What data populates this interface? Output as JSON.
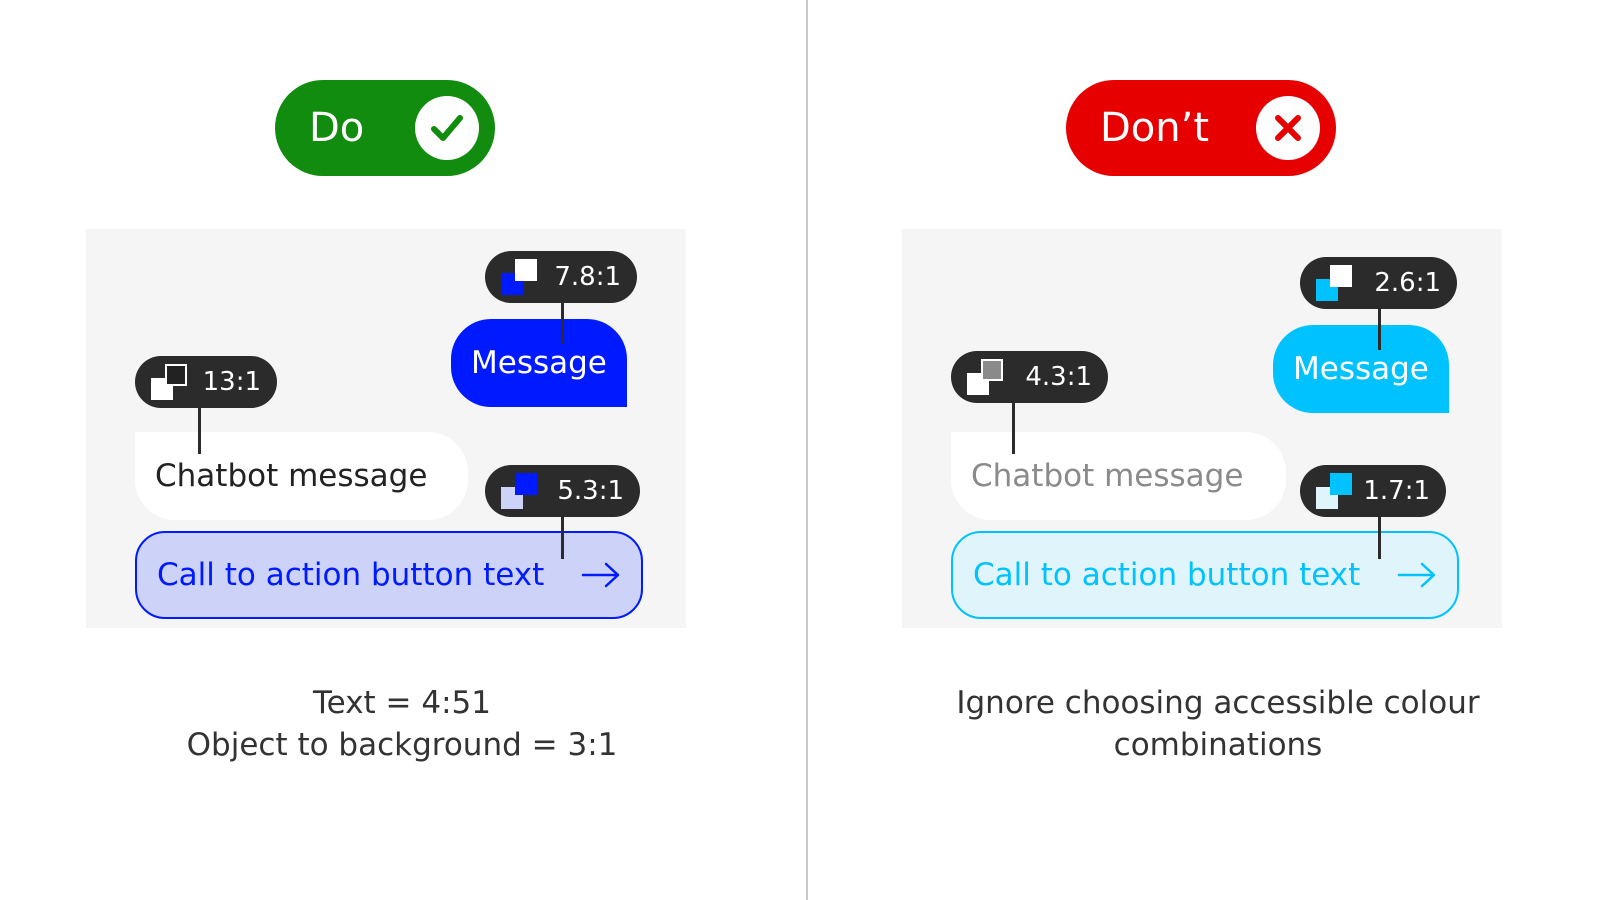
{
  "colors": {
    "do_badge": "#118c0e",
    "dont_badge": "#e60000",
    "do_primary": "#001aff",
    "do_cta_bg": "#ccd2f8",
    "dont_primary": "#00c2ff",
    "dont_cta_bg": "#e0f4fb",
    "tag_bg": "#2b2b2b",
    "panel_bg": "#f5f5f5"
  },
  "do": {
    "label": "Do",
    "icon": "check-icon",
    "message": "Message",
    "message_ratio": "7.8:1",
    "chatbot": "Chatbot message",
    "chatbot_ratio": "13:1",
    "cta": "Call to action button text",
    "cta_ratio": "5.3:1",
    "caption_line1": "Text = 4:51",
    "caption_line2": "Object to background = 3:1"
  },
  "dont": {
    "label": "Don’t",
    "icon": "x-icon",
    "message": "Message",
    "message_ratio": "2.6:1",
    "chatbot": "Chatbot message",
    "chatbot_ratio": "4.3:1",
    "cta": "Call to action button text",
    "cta_ratio": "1.7:1",
    "caption_line1": "Ignore choosing accessible colour",
    "caption_line2": "combinations"
  }
}
